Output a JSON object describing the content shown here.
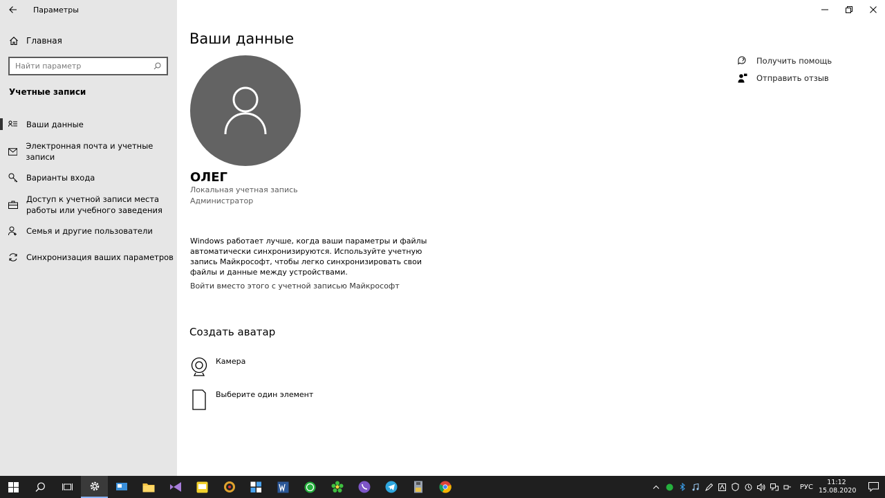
{
  "window": {
    "title": "Параметры"
  },
  "sidebar": {
    "home_label": "Главная",
    "search_placeholder": "Найти параметр",
    "section_title": "Учетные записи",
    "items": [
      {
        "label": "Ваши данные",
        "icon": "person-card-icon",
        "active": true
      },
      {
        "label": "Электронная почта и учетные записи",
        "icon": "mail-icon",
        "active": false
      },
      {
        "label": "Варианты входа",
        "icon": "key-icon",
        "active": false
      },
      {
        "label": "Доступ к учетной записи места работы или учебного заведения",
        "icon": "briefcase-icon",
        "active": false
      },
      {
        "label": "Семья и другие пользователи",
        "icon": "people-icon",
        "active": false
      },
      {
        "label": "Синхронизация ваших параметров",
        "icon": "sync-icon",
        "active": false
      }
    ]
  },
  "main": {
    "page_title": "Ваши данные",
    "user_name": "ОЛЕГ",
    "account_type": "Локальная учетная запись",
    "account_role": "Администратор",
    "sync_text": "Windows работает лучше, когда ваши параметры и файлы автоматически синхронизируются. Используйте учетную запись Майкрософт, чтобы легко синхронизировать свои файлы и данные между устройствами.",
    "sync_link": "Войти вместо этого с учетной записью Майкрософт",
    "avatar_section_title": "Создать аватар",
    "avatar_options": [
      {
        "label": "Камера",
        "icon": "camera-icon"
      },
      {
        "label": "Выберите один элемент",
        "icon": "file-icon"
      }
    ]
  },
  "help": {
    "get_help": "Получить помощь",
    "feedback": "Отправить отзыв"
  },
  "taskbar": {
    "language": "РУС",
    "time": "11:12",
    "date": "15.08.2020"
  },
  "colors": {
    "sidebar_bg": "#e6e6e6",
    "avatar_bg": "#636363",
    "taskbar_bg": "#1f1f1f"
  }
}
